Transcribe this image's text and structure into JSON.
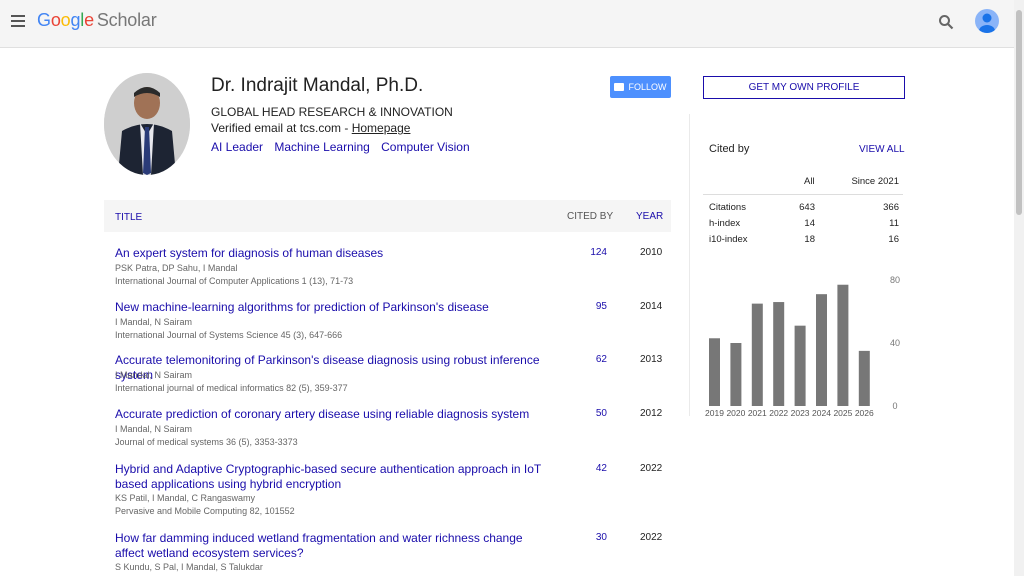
{
  "header": {
    "logo_google": "Google",
    "logo_scholar": "Scholar"
  },
  "profile": {
    "name": "Dr. Indrajit Mandal, Ph.D.",
    "affiliation": "GLOBAL HEAD RESEARCH & INNOVATION",
    "email_text": "Verified email at tcs.com - ",
    "homepage_label": "Homepage",
    "interests": [
      "AI Leader",
      "Machine Learning",
      "Computer Vision"
    ],
    "follow_label": "FOLLOW"
  },
  "table": {
    "title_header": "TITLE",
    "cited_header": "CITED BY",
    "year_header": "YEAR"
  },
  "publications": [
    {
      "title": "An expert system for diagnosis of human diseases",
      "authors": "PSK Patra, DP Sahu, I Mandal",
      "venue": "International Journal of Computer Applications 1 (13), 71-73",
      "cited": "124",
      "year": "2010"
    },
    {
      "title": "New machine-learning algorithms for prediction of Parkinson's disease",
      "authors": "I Mandal, N Sairam",
      "venue": "International Journal of Systems Science 45 (3), 647-666",
      "cited": "95",
      "year": "2014"
    },
    {
      "title": "Accurate telemonitoring of Parkinson's disease diagnosis using robust inference system",
      "authors": "I Mandal, N Sairam",
      "venue": "International journal of medical informatics 82 (5), 359-377",
      "cited": "62",
      "year": "2013"
    },
    {
      "title": "Accurate prediction of coronary artery disease using reliable diagnosis system",
      "authors": "I Mandal, N Sairam",
      "venue": "Journal of medical systems 36 (5), 3353-3373",
      "cited": "50",
      "year": "2012"
    },
    {
      "title": "Hybrid and Adaptive Cryptographic-based secure authentication approach in IoT based applications using hybrid encryption",
      "authors": "KS Patil, I Mandal, C Rangaswamy",
      "venue": "Pervasive and Mobile Computing 82, 101552",
      "cited": "42",
      "year": "2022"
    },
    {
      "title": "How far damming induced wetland fragmentation and water richness change affect wetland ecosystem services?",
      "authors": "S Kundu, S Pal, I Mandal, S Talukdar",
      "venue": "",
      "cited": "30",
      "year": "2022"
    }
  ],
  "sidebar": {
    "own_profile_label": "GET MY OWN PROFILE",
    "cited_by_label": "Cited by",
    "view_all_label": "VIEW ALL",
    "col_all": "All",
    "col_since": "Since 2021",
    "metrics": [
      {
        "label": "Citations",
        "all": "643",
        "since": "366"
      },
      {
        "label": "h-index",
        "all": "14",
        "since": "11"
      },
      {
        "label": "i10-index",
        "all": "18",
        "since": "16"
      }
    ]
  },
  "chart_data": {
    "type": "bar",
    "categories": [
      "2019",
      "2020",
      "2021",
      "2022",
      "2023",
      "2024",
      "2025",
      "2026"
    ],
    "values": [
      43,
      40,
      65,
      66,
      51,
      71,
      77,
      35
    ],
    "ylim": [
      0,
      80
    ],
    "yticks": [
      "80",
      "40",
      "0"
    ],
    "bar_color": "#777777"
  }
}
